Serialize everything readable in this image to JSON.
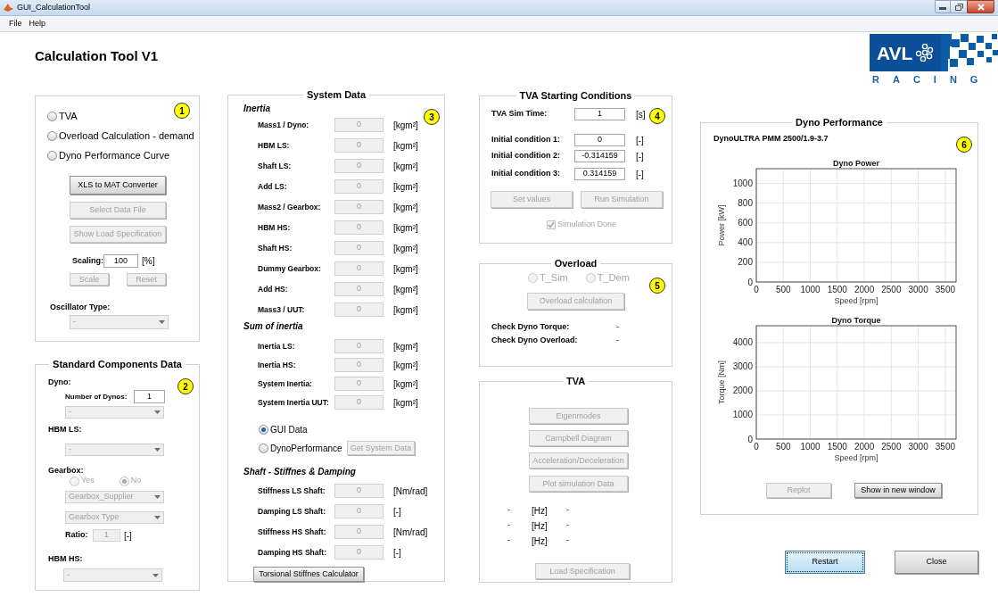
{
  "window": {
    "title": "GUI_CalculationTool"
  },
  "menu": [
    "File",
    "Help"
  ],
  "heading": "Calculation Tool V1",
  "logo": {
    "text": "AVL",
    "subtitle": "RACING"
  },
  "mode_panel": {
    "badge": "1",
    "modes": [
      {
        "label": "TVA",
        "selected": false
      },
      {
        "label": "Overload Calculation - demand",
        "selected": false
      },
      {
        "label": "Dyno Performance Curve",
        "selected": false
      }
    ],
    "buttons": [
      {
        "label": "XLS to MAT Converter",
        "disabled": false
      },
      {
        "label": "Select Data File",
        "disabled": true
      },
      {
        "label": "Show Load Specification",
        "disabled": true
      }
    ],
    "scaling": {
      "label": "Scaling:",
      "value": "100",
      "unit": "[%]",
      "disabled": false
    },
    "scale_buttons": [
      {
        "label": "Scale",
        "disabled": true
      },
      {
        "label": "Reset",
        "disabled": true
      }
    ],
    "oscillator": {
      "label": "Oscillator Type:",
      "value": "-",
      "disabled": true
    }
  },
  "standard_components": {
    "title": "Standard Components Data",
    "badge": "2",
    "dyno_label": "Dyno:",
    "dynos": {
      "label": "Number of Dynos:",
      "value": "1",
      "disabled": false
    },
    "dyno_select": {
      "value": "-",
      "disabled": true
    },
    "hbm_ls_label": "HBM LS:",
    "hbm_ls_select": {
      "value": "-",
      "disabled": true
    },
    "gearbox_label": "Gearbox:",
    "gearbox_options": [
      {
        "label": "Yes",
        "selected": false,
        "disabled": true
      },
      {
        "label": "No",
        "selected": true,
        "disabled": true
      }
    ],
    "gearbox_selects": [
      {
        "value": "Gearbox_Supplier",
        "disabled": true
      },
      {
        "value": "Gearbox Type",
        "disabled": true
      }
    ],
    "ratio": {
      "label": "Ratio:",
      "value": "1",
      "unit": "[-]",
      "disabled": true
    },
    "hbm_hs_label": "HBM HS:",
    "hbm_hs_select": {
      "value": "-",
      "disabled": true
    }
  },
  "system_data": {
    "title": "System Data",
    "badge": "3",
    "inertia": {
      "heading": "Inertia",
      "rows": [
        {
          "label": "Mass1 / Dyno:",
          "value": "0",
          "unit": "[kgm²]",
          "disabled": true
        },
        {
          "label": "HBM LS:",
          "value": "0",
          "unit": "[kgm²]",
          "disabled": true
        },
        {
          "label": "Shaft LS:",
          "value": "0",
          "unit": "[kgm²]",
          "disabled": true
        },
        {
          "label": "Add LS:",
          "value": "0",
          "unit": "[kgm²]",
          "disabled": true
        },
        {
          "label": "Mass2 / Gearbox:",
          "value": "0",
          "unit": "[kgm²]",
          "disabled": true
        },
        {
          "label": "HBM HS:",
          "value": "0",
          "unit": "[kgm²]",
          "disabled": true
        },
        {
          "label": "Shaft HS:",
          "value": "0",
          "unit": "[kgm²]",
          "disabled": true
        },
        {
          "label": "Dummy Gearbox:",
          "value": "0",
          "unit": "[kgm²]",
          "disabled": true
        },
        {
          "label": "Add HS:",
          "value": "0",
          "unit": "[kgm²]",
          "disabled": true
        },
        {
          "label": "Mass3 / UUT:",
          "value": "0",
          "unit": "[kgm²]",
          "disabled": true
        }
      ]
    },
    "sum": {
      "heading": "Sum of inertia",
      "rows": [
        {
          "label": "Inertia LS:",
          "value": "0",
          "unit": "[kgm²]",
          "disabled": true
        },
        {
          "label": "Inertia HS:",
          "value": "0",
          "unit": "[kgm²]",
          "disabled": true
        },
        {
          "label": "System Inertia:",
          "value": "0",
          "unit": "[kgm²]",
          "disabled": true
        },
        {
          "label": "System Inertia UUT:",
          "value": "0",
          "unit": "[kgm²]",
          "disabled": true
        }
      ]
    },
    "sources": [
      {
        "label": "GUI Data",
        "selected": true
      },
      {
        "label": "DynoPerformance",
        "selected": false
      }
    ],
    "get_button": {
      "label": "Get System Data",
      "disabled": true
    },
    "shaft": {
      "heading": "Shaft - Stiffnes & Damping",
      "rows": [
        {
          "label": "Stiffness LS Shaft:",
          "value": "0",
          "unit": "[Nm/rad]",
          "disabled": true
        },
        {
          "label": "Damping LS Shaft:",
          "value": "0",
          "unit": "[-]",
          "disabled": true
        },
        {
          "label": "Stiffness HS Shaft:",
          "value": "0",
          "unit": "[Nm/rad]",
          "disabled": true
        },
        {
          "label": "Damping HS Shaft:",
          "value": "0",
          "unit": "[-]",
          "disabled": true
        }
      ]
    },
    "calculator_button": {
      "label": "Torsional Stiffnes Calculator",
      "disabled": false
    }
  },
  "tva_start": {
    "title": "TVA Starting Conditions",
    "badge": "4",
    "rows": [
      {
        "label": "TVA Sim Time:",
        "value": "1",
        "unit": "[s]",
        "disabled": false
      },
      {
        "label": "Initial condition 1:",
        "value": "0",
        "unit": "[-]",
        "disabled": false
      },
      {
        "label": "Initial condition 2:",
        "value": "-0.314159",
        "unit": "[-]",
        "disabled": false
      },
      {
        "label": "Initial condition 3:",
        "value": "0.314159",
        "unit": "[-]",
        "disabled": false
      }
    ],
    "buttons": [
      {
        "label": "Set values",
        "disabled": true
      },
      {
        "label": "Run Simulation",
        "disabled": true
      }
    ],
    "sim_done": {
      "label": "Simulation Done",
      "checked": true,
      "disabled": true
    }
  },
  "overload": {
    "title": "Overload",
    "badge": "5",
    "options": [
      {
        "label": "T_Sim",
        "selected": false,
        "disabled": true
      },
      {
        "label": "T_Dem",
        "selected": false,
        "disabled": true
      }
    ],
    "button": {
      "label": "Overload calculation",
      "disabled": true
    },
    "checks": [
      {
        "label": "Check Dyno Torque:",
        "value": "-"
      },
      {
        "label": "Check Dyno Overload:",
        "value": "-"
      }
    ]
  },
  "tva": {
    "title": "TVA",
    "buttons": [
      {
        "label": "Eigenmodes",
        "disabled": true
      },
      {
        "label": "Campbell Diagram",
        "disabled": true
      },
      {
        "label": "Acceleration/Deceleration",
        "disabled": true
      },
      {
        "label": "Plot simulation Data",
        "disabled": true
      }
    ],
    "frequencies": [
      {
        "value": "-",
        "unit": "[Hz]",
        "note": "-"
      },
      {
        "value": "-",
        "unit": "[Hz]",
        "note": "-"
      },
      {
        "value": "-",
        "unit": "[Hz]",
        "note": "-"
      }
    ],
    "load_button": {
      "label": "Load Specification",
      "disabled": true
    }
  },
  "dyno_performance": {
    "title": "Dyno Performance",
    "badge": "6",
    "model": "DynoULTRA PMM 2500/1.9-3.7",
    "charts": [
      {
        "chart_data": {
          "type": "line",
          "title": "Dyno Power",
          "xlabel": "Speed [rpm]",
          "ylabel": "Power [kW]",
          "xlim": [
            0,
            3700
          ],
          "ylim": [
            0,
            1150
          ],
          "xticks": [
            0,
            500,
            1000,
            1500,
            2000,
            2500,
            3000,
            3500
          ],
          "yticks": [
            0,
            200,
            400,
            600,
            800,
            1000
          ],
          "grid": true
        }
      },
      {
        "chart_data": {
          "type": "line",
          "title": "Dyno Torque",
          "xlabel": "Speed [rpm]",
          "ylabel": "Torque [Nm]",
          "xlim": [
            0,
            3700
          ],
          "ylim": [
            0,
            4700
          ],
          "xticks": [
            0,
            500,
            1000,
            1500,
            2000,
            2500,
            3000,
            3500
          ],
          "yticks": [
            0,
            1000,
            2000,
            3000,
            4000
          ],
          "grid": true
        }
      }
    ],
    "buttons": [
      {
        "label": "Replot",
        "disabled": true
      },
      {
        "label": "Show in new window",
        "disabled": false
      }
    ]
  },
  "footer_buttons": [
    {
      "label": "Restart",
      "focused": true
    },
    {
      "label": "Close",
      "focused": false
    }
  ]
}
